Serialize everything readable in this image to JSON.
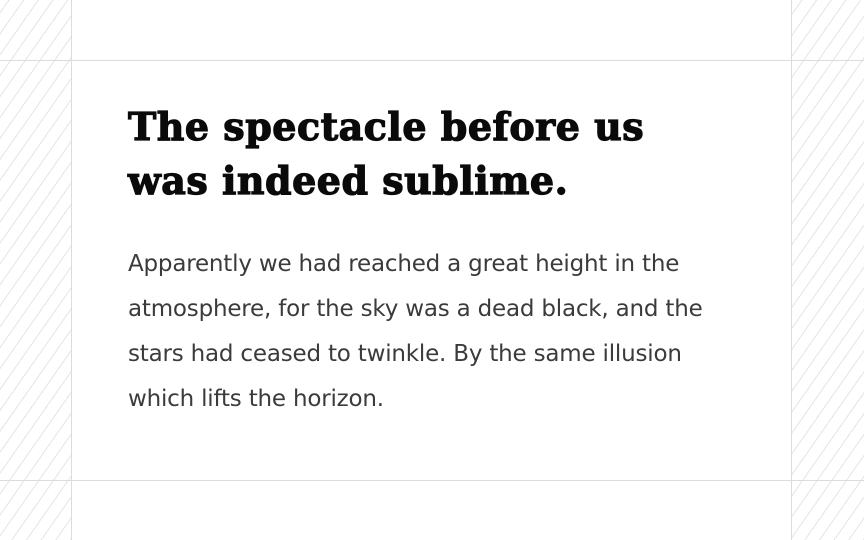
{
  "article": {
    "headline": "The spectacle before us was indeed sublime.",
    "body": "Apparently we had reached a great height in the atmosphere, for the sky was a dead black, and the stars had ceased to twinkle. By the same illusion which lifts the horizon."
  },
  "colors": {
    "headline": "#0a0a0a",
    "body": "#3b3b3b",
    "grid_lines": "#dcdcdc",
    "hatch": "#e4e4e4",
    "background": "#ffffff"
  }
}
